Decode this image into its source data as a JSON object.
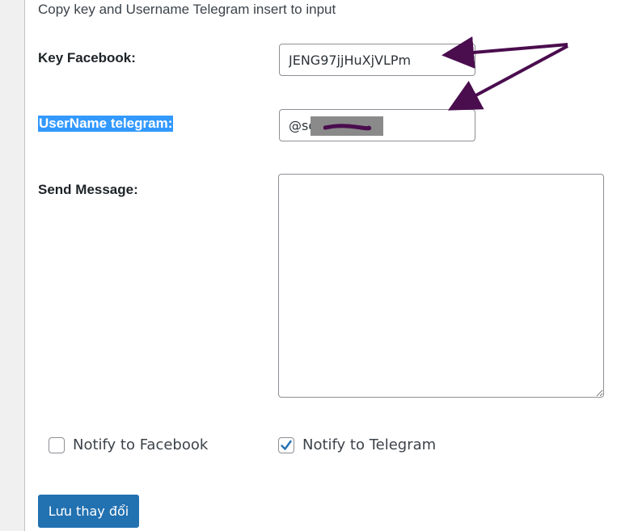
{
  "form": {
    "hint": "Copy key and Username Telegram insert to input",
    "key_label": "Key Facebook:",
    "key_value": "JENG97jjHuXjVLPm",
    "username_label": "UserName telegram:",
    "username_value": "@sonweb",
    "message_label": "Send Message:",
    "message_value": ""
  },
  "options": {
    "facebook": {
      "label": "Notify to Facebook",
      "checked": false
    },
    "telegram": {
      "label": "Notify to Telegram",
      "checked": true
    }
  },
  "actions": {
    "save_label": "Lưu thay đổi"
  },
  "colors": {
    "primary": "#2271b1",
    "selection": "#3399ff",
    "annotation": "#4a0d4e"
  }
}
